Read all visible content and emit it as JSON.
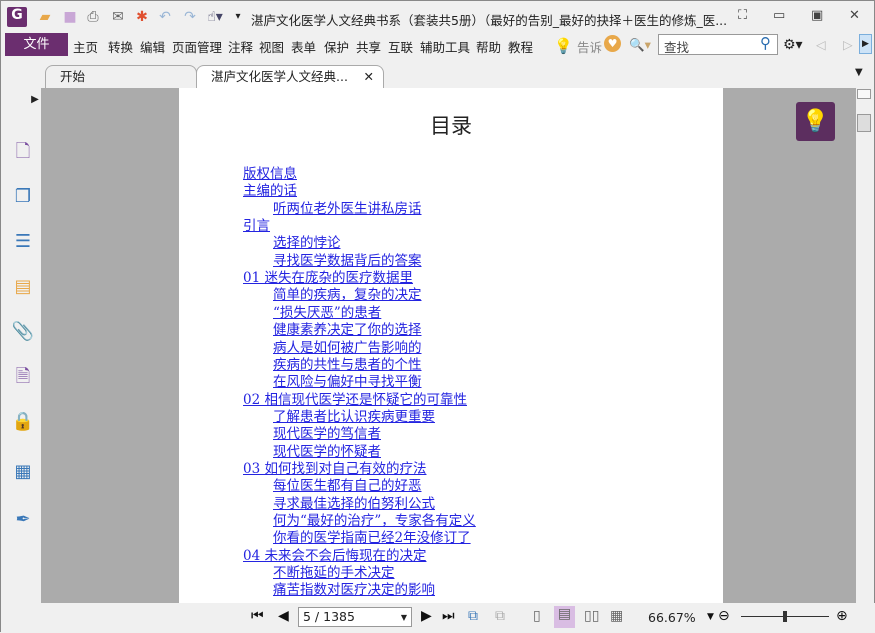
{
  "window": {
    "title": "湛庐文化医学人文经典书系（套装共5册）（最好的告别_最好的抉择＋医生的修炼_医..."
  },
  "menu": {
    "file": "文件",
    "items": [
      "主页",
      "转换",
      "编辑",
      "页面管理",
      "注释",
      "视图",
      "表单",
      "保护",
      "共享",
      "互联",
      "辅助工具",
      "帮助",
      "教程"
    ],
    "tell_me": "告诉"
  },
  "search": {
    "placeholder": "查找"
  },
  "tabs": [
    {
      "label": "开始"
    },
    {
      "label": "湛庐文化医学人文经典..."
    }
  ],
  "document": {
    "title": "目录",
    "toc": [
      {
        "text": "版权信息",
        "level": 1
      },
      {
        "text": "主编的话",
        "level": 1
      },
      {
        "text": "听两位老外医生讲私房话",
        "level": 2
      },
      {
        "text": "引言",
        "level": 1
      },
      {
        "text": "选择的悖论",
        "level": 2
      },
      {
        "text": "寻找医学数据背后的答案",
        "level": 2
      },
      {
        "text": "01 迷失在庞杂的医疗数据里",
        "level": 1
      },
      {
        "text": "简单的疾病，复杂的决定",
        "level": 2
      },
      {
        "text": "“损失厌恶”的患者",
        "level": 2
      },
      {
        "text": "健康素养决定了你的选择",
        "level": 2
      },
      {
        "text": "病人是如何被广告影响的",
        "level": 2
      },
      {
        "text": "疾病的共性与患者的个性",
        "level": 2
      },
      {
        "text": "在风险与偏好中寻找平衡",
        "level": 2
      },
      {
        "text": "02 相信现代医学还是怀疑它的可靠性",
        "level": 1
      },
      {
        "text": "了解患者比认识疾病更重要",
        "level": 2
      },
      {
        "text": "现代医学的笃信者",
        "level": 2
      },
      {
        "text": "现代医学的怀疑者",
        "level": 2
      },
      {
        "text": "03 如何找到对自己有效的疗法",
        "level": 1
      },
      {
        "text": "每位医生都有自己的好恶",
        "level": 2
      },
      {
        "text": "寻求最佳选择的伯努利公式",
        "level": 2
      },
      {
        "text": "何为“最好的治疗”，专家各有定义",
        "level": 2
      },
      {
        "text": "你看的医学指南已经2年没修订了",
        "level": 2
      },
      {
        "text": "04 未来会不会后悔现在的决定",
        "level": 1
      },
      {
        "text": "不断拖延的手术决定",
        "level": 2
      },
      {
        "text": "痛苦指数对医疗决定的影响",
        "level": 2
      }
    ]
  },
  "statusbar": {
    "page": "5 / 1385",
    "zoom": "66.67%",
    "zoom_slider_fraction": 0.5
  },
  "colors": {
    "accent": "#6b2e6f",
    "link": "#2424e0"
  }
}
